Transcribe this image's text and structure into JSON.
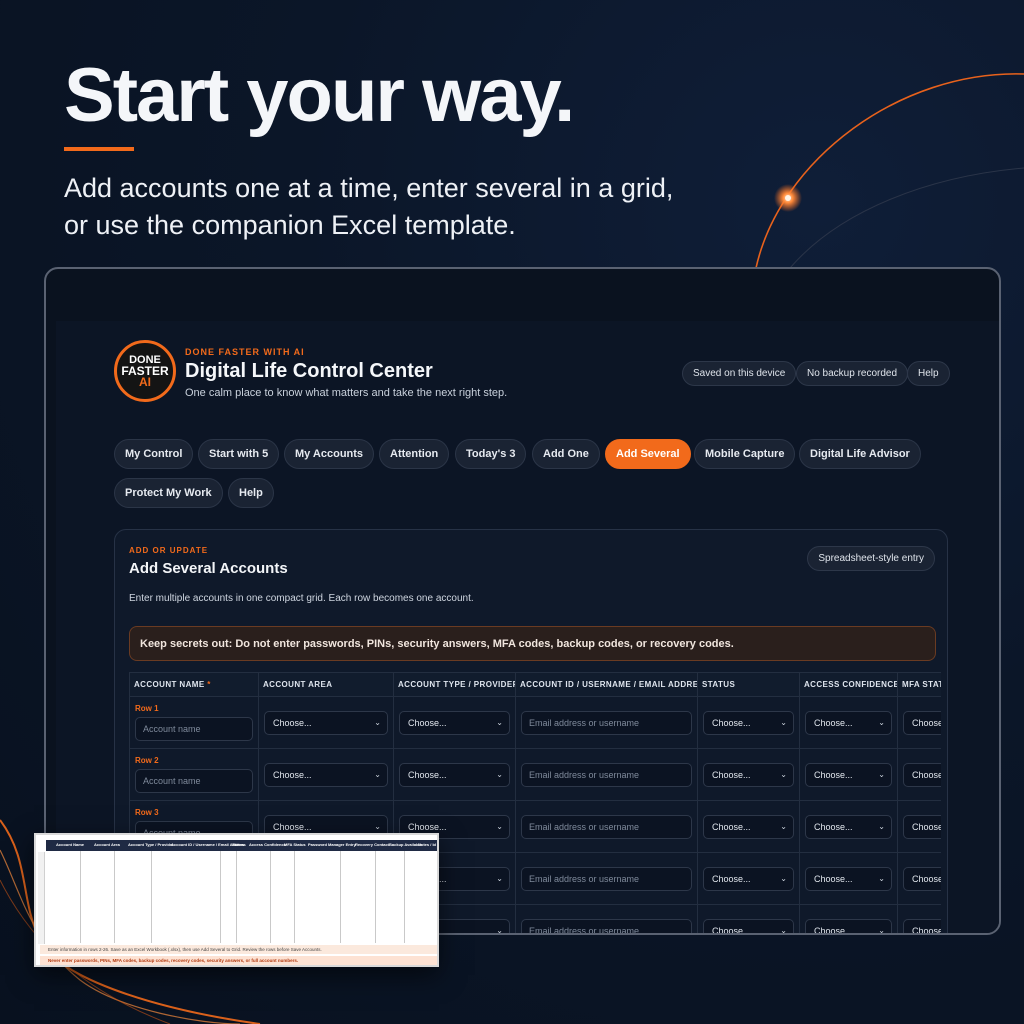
{
  "hero": {
    "title": "Start your way.",
    "subtitle_line1": "Add accounts one at a time, enter several in a grid,",
    "subtitle_line2": "or use the companion Excel template."
  },
  "app": {
    "logo": {
      "line1": "DONE",
      "line2": "FASTER",
      "line3": "AI"
    },
    "brand": "DONE FASTER WITH AI",
    "title": "Digital Life Control Center",
    "subtitle": "One calm place to know what matters and take the next right step.",
    "header_chips": [
      "Saved on this device",
      "No backup recorded",
      "Help"
    ]
  },
  "tabs": [
    {
      "label": "My Control",
      "active": false
    },
    {
      "label": "Start with 5",
      "active": false
    },
    {
      "label": "My Accounts",
      "active": false
    },
    {
      "label": "Attention",
      "active": false
    },
    {
      "label": "Today's 3",
      "active": false
    },
    {
      "label": "Add One",
      "active": false
    },
    {
      "label": "Add Several",
      "active": true
    },
    {
      "label": "Mobile Capture",
      "active": false
    },
    {
      "label": "Digital Life Advisor",
      "active": false
    },
    {
      "label": "Protect My Work",
      "active": false
    },
    {
      "label": "Help",
      "active": false
    }
  ],
  "panel": {
    "eyebrow": "ADD OR UPDATE",
    "title": "Add Several Accounts",
    "chip": "Spreadsheet-style entry",
    "description": "Enter multiple accounts in one compact grid. Each row becomes one account.",
    "warning": "Keep secrets out: Do not enter passwords, PINs, security answers, MFA codes, backup codes, or recovery codes."
  },
  "grid": {
    "columns": [
      "ACCOUNT NAME",
      "ACCOUNT AREA",
      "ACCOUNT TYPE / PROVIDER",
      "ACCOUNT ID / USERNAME / EMAIL ADDRESS",
      "STATUS",
      "ACCESS CONFIDENCE",
      "MFA STATUS"
    ],
    "required_marker": "*",
    "row_labels": [
      "Row 1",
      "Row 2",
      "Row 3"
    ],
    "account_name_placeholder": "Account name",
    "email_placeholder": "Email address or username",
    "select_value": "Choose...",
    "chevron": "⌄"
  },
  "excel": {
    "headers": [
      "Account Name",
      "Account Area",
      "Account Type / Provider",
      "Account ID / Username / Email Address",
      "Status",
      "Access Confidence",
      "MFA Status",
      "Password Manager Entry",
      "Recovery Contact",
      "Backup Available",
      "Notes / Id"
    ],
    "note1": "Enter information in rows 2-26. Save as an Excel Workbook (.xlsx), then use Add Several to Grid. Review the rows before Save Accounts.",
    "note2": "Never enter passwords, PINs, MFA codes, backup codes, recovery codes, security answers, or full account numbers."
  },
  "colors": {
    "accent": "#f26a1b",
    "background": "#0b1628",
    "panel": "#0f192a"
  }
}
